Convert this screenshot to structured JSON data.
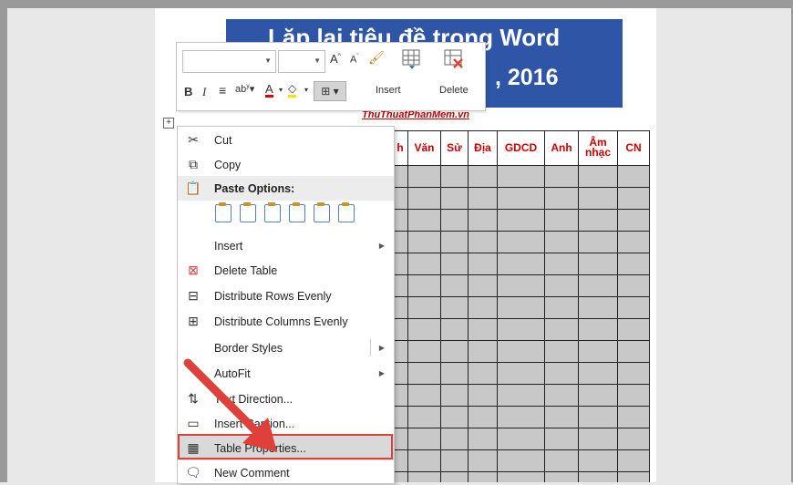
{
  "document": {
    "banner_line1": "Lặp lại tiêu đề trong Word",
    "banner_line2": ", 2016",
    "site": "ThuThuatPhanMem.vn",
    "table_headers": [
      "h",
      "Văn",
      "Sử",
      "Địa",
      "GDCD",
      "Anh",
      "Âm nhạc",
      "CN"
    ]
  },
  "mini_toolbar": {
    "bold": "B",
    "italic": "I",
    "insert_label": "Insert",
    "delete_label": "Delete"
  },
  "context_menu": {
    "items": [
      {
        "label": "Cut",
        "icon": "scissors-icon"
      },
      {
        "label": "Copy",
        "icon": "copy-icon"
      },
      {
        "label": "Paste Options:",
        "icon": "paste-icon"
      },
      {
        "label": "Insert",
        "submenu": true
      },
      {
        "label": "Delete Table",
        "icon": "delete-table-icon"
      },
      {
        "label": "Distribute Rows Evenly",
        "icon": "distribute-rows-icon"
      },
      {
        "label": "Distribute Columns Evenly",
        "icon": "distribute-columns-icon"
      },
      {
        "label": "Border Styles",
        "submenu": true
      },
      {
        "label": "AutoFit",
        "submenu": true
      },
      {
        "label": "Text Direction...",
        "icon": "text-direction-icon"
      },
      {
        "label": "Insert Caption...",
        "icon": "caption-icon"
      },
      {
        "label": "Table Properties...",
        "icon": "table-properties-icon",
        "highlighted": true
      },
      {
        "label": "New Comment",
        "icon": "comment-icon"
      }
    ]
  },
  "colors": {
    "banner": "#2e55a6",
    "header_text": "#cc0000",
    "highlight_border": "#e0403a",
    "arrow": "#e0403a"
  }
}
